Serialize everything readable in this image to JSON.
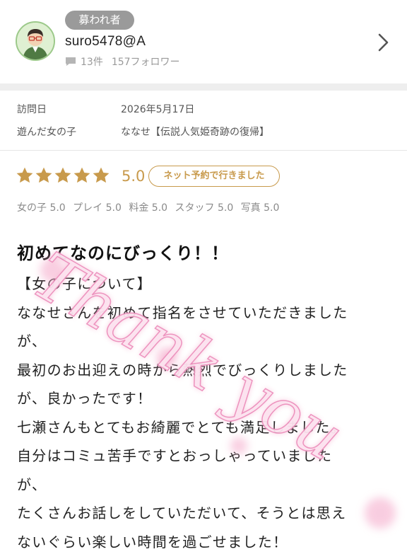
{
  "header": {
    "badge": "募われ者",
    "username": "suro5478@A",
    "review_count": "13件",
    "followers": "157フォロワー",
    "icons": {
      "avatar": "user-avatar-glasses",
      "comment": "comment-icon",
      "more": "chevron-right-icon"
    }
  },
  "visit": {
    "date_label": "訪問日",
    "date_value": "2026年5月17日",
    "girl_label": "遊んだ女の子",
    "girl_value": "ななせ【伝説人気姫奇跡の復帰】"
  },
  "rating": {
    "stars": 5,
    "score": "5.0",
    "badge": "ネット予約で行きました",
    "subscores": [
      "女の子 5.0",
      "プレイ 5.0",
      "料金 5.0",
      "スタッフ 5.0",
      "写真 5.0"
    ],
    "star_color": "#c89a4c"
  },
  "review": {
    "title": "初めてなのにびっくり！！",
    "lines": [
      "【女の子について】",
      "ななせさんを初めて指名をさせていただきました",
      "が、",
      "最初のお出迎えの時から熱烈でびっくりしました",
      "が、良かったです！",
      "七瀬さんもとてもお綺麗でとても満足しました。",
      "自分はコミュ苦手ですとおっしゃっていました",
      "が、",
      "たくさんお話しをしていただいて、そうとは思え",
      "ないぐらい楽しい時間を過ごせました！"
    ]
  },
  "overlay": {
    "text": "Thank you",
    "color": "#f4a6c8"
  }
}
